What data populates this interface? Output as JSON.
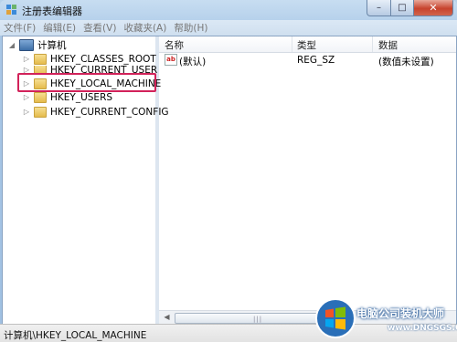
{
  "window": {
    "title": "注册表编辑器",
    "minimize_glyph": "–",
    "maximize_glyph": "□",
    "close_glyph": "✕"
  },
  "menu": [
    "文件(F)",
    "编辑(E)",
    "查看(V)",
    "收藏夹(A)",
    "帮助(H)"
  ],
  "tree": {
    "root": "计算机",
    "items": [
      {
        "label": "HKEY_CLASSES_ROOT"
      },
      {
        "label": "HKEY_CURRENT_USER"
      },
      {
        "label": "HKEY_LOCAL_MACHINE",
        "highlighted": true
      },
      {
        "label": "HKEY_USERS"
      },
      {
        "label": "HKEY_CURRENT_CONFIG"
      }
    ],
    "highlight_color": "#d2225a"
  },
  "list": {
    "columns": [
      "名称",
      "类型",
      "数据"
    ],
    "rows": [
      {
        "name": "(默认)",
        "type": "REG_SZ",
        "data": "(数值未设置)",
        "icon": "ab-icon"
      }
    ]
  },
  "status": {
    "path": "计算机\\HKEY_LOCAL_MACHINE"
  },
  "watermark": {
    "brand": "电脑公司装机大师",
    "url": "www.DNGSGS.COM"
  }
}
